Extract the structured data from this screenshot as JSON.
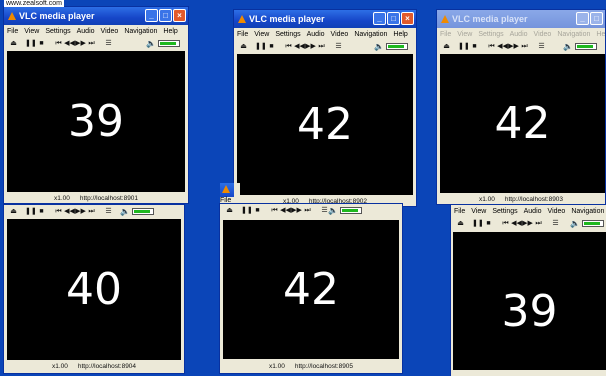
{
  "watermark": "www.zealsoft.com",
  "app_title": "VLC media player",
  "menu": [
    "File",
    "View",
    "Settings",
    "Audio",
    "Video",
    "Navigation",
    "Help"
  ],
  "toolbar_icons": [
    "eject-icon",
    "pause-icon",
    "stop-icon",
    "previous-icon",
    "rewind-icon",
    "fast-forward-icon",
    "next-icon",
    "playlist-icon"
  ],
  "volume_level": 0.9,
  "windows": [
    {
      "number": "39",
      "speed": "x1.00",
      "url": "http://localhost:8901"
    },
    {
      "number": "42",
      "speed": "x1.00",
      "url": "http://localhost:8902"
    },
    {
      "number": "42",
      "speed": "x1.00",
      "url": "http://localhost:8903"
    },
    {
      "number": "40",
      "speed": "x1.00",
      "url": "http://localhost:8904"
    },
    {
      "number": "42",
      "speed": "x1.00",
      "url": "http://localhost:8905"
    },
    {
      "number": "39",
      "speed": "",
      "url": ""
    }
  ],
  "partial_window_menu": "File",
  "partial_window_title": "V"
}
